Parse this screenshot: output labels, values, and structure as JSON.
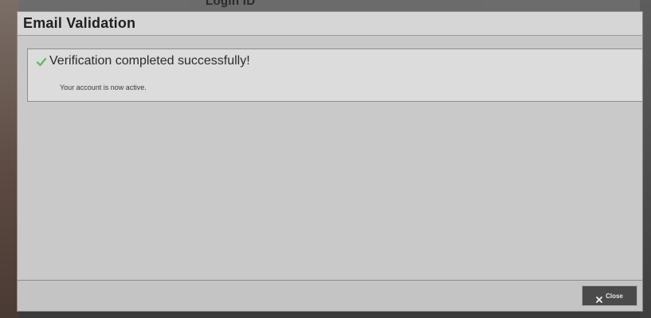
{
  "background": {
    "behind_label": "Login ID"
  },
  "dialog": {
    "title": "Email Validation",
    "alert": {
      "icon": "check-icon",
      "title": "Verification completed successfully!",
      "message": "Your account is now active.",
      "icon_color": "#5cb85c"
    },
    "footer": {
      "close_icon": "close-icon",
      "close_label": "Close"
    }
  },
  "colors": {
    "dialog_bg": "#c9c9c9",
    "alert_bg": "#dcdcdc",
    "close_button_bg": "#4a4a4a"
  }
}
